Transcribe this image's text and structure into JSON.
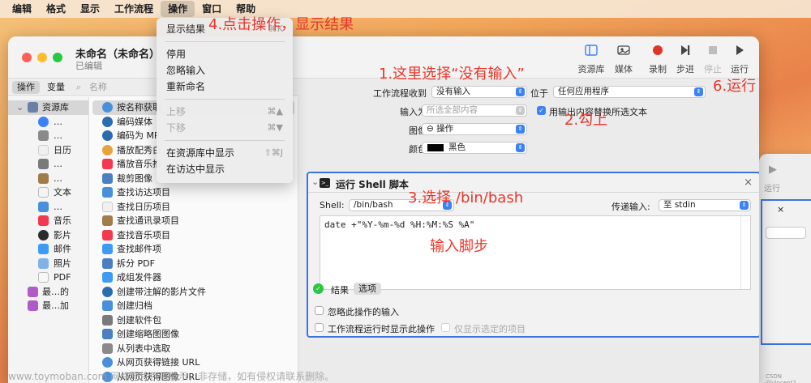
{
  "menubar": {
    "items": [
      "编辑",
      "格式",
      "显示",
      "工作流程",
      "操作",
      "窗口",
      "帮助"
    ],
    "active": "操作"
  },
  "dropdown": {
    "items": [
      {
        "label": "显示结果",
        "shortcut": "⌘K",
        "disabled": false
      },
      {
        "label": "停用",
        "shortcut": "",
        "disabled": false
      },
      {
        "label": "忽略输入",
        "shortcut": "",
        "disabled": false
      },
      {
        "label": "重新命名",
        "shortcut": "",
        "disabled": false
      },
      {
        "label": "上移",
        "shortcut": "⌘▲",
        "disabled": true
      },
      {
        "label": "下移",
        "shortcut": "⌘▼",
        "disabled": true
      },
      {
        "label": "在资源库中显示",
        "shortcut": "⇧⌘J",
        "disabled": false
      },
      {
        "label": "在访达中显示",
        "shortcut": "",
        "disabled": false
      }
    ]
  },
  "window": {
    "title": "未命名（未命名）",
    "subtitle": "已编辑",
    "toolbar": {
      "library": "资源库",
      "media": "媒体",
      "record": "录制",
      "step": "步进",
      "stop": "停止",
      "run": "运行"
    },
    "pane_tabs": {
      "actions": "操作",
      "variables": "变量",
      "search_placeholder": "名称"
    },
    "library": {
      "root": "资源库",
      "items": [
        "…",
        "…",
        "日历",
        "…",
        "…",
        "文本",
        "…",
        "音乐",
        "影片",
        "邮件",
        "照片",
        "PDF"
      ],
      "smart": [
        "最…的",
        "最…加"
      ]
    },
    "actions": [
      "按名称获取",
      "编码媒体",
      "编码为 MP",
      "播放配秀白",
      "播放音乐推",
      "裁剪图像",
      "查找访达项目",
      "查找日历项目",
      "查找通讯录项目",
      "查找音乐项目",
      "查找邮件项",
      "拆分 PDF",
      "成组发件器",
      "创建带注解的影片文件",
      "创建归档",
      "创建软件包",
      "创建缩略图图像",
      "从列表中选取",
      "从网页获得链接 URL",
      "从网页获得图像 URL"
    ],
    "workflow": {
      "receives_label": "工作流程收到",
      "receives_value": "没有输入",
      "in_label": "位于",
      "in_value": "任何应用程序",
      "input_label": "输入为",
      "input_value": "所选全部内容",
      "replace_label": "用输出内容替换所选文本",
      "image_label": "图像",
      "image_value": "⊖ 操作",
      "color_label": "颜色",
      "color_value": "黑色"
    },
    "shell": {
      "title": "运行 Shell 脚本",
      "shell_label": "Shell:",
      "shell_value": "/bin/bash",
      "pass_label": "传递输入:",
      "pass_value": "至 stdin",
      "code": "date +\"%Y-%m-%d %H:%M:%S %A\"",
      "results": "结果",
      "options": "选项",
      "ignore_input": "忽略此操作的输入",
      "show_when_run": "工作流程运行时显示此操作",
      "show_selected": "仅显示选定的项目"
    }
  },
  "win2": {
    "run": "运行"
  },
  "annotations": {
    "a4": "4.点击操作，显示结果",
    "a1": "1.这里选择“没有输入”",
    "a6": "6.运行",
    "a2": "2.勾上",
    "a3": "3.选择 /bin/bash",
    "a5": "输入脚步"
  },
  "watermark": "www.toymoban.com 网络图片仅供展示，非存储，如有侵权请联系删除。",
  "csdn": "CSDN @Vincent2",
  "colors": {
    "accent": "#3b82f6",
    "annotation": "#e8362a",
    "selection_border": "#3d74d8"
  }
}
